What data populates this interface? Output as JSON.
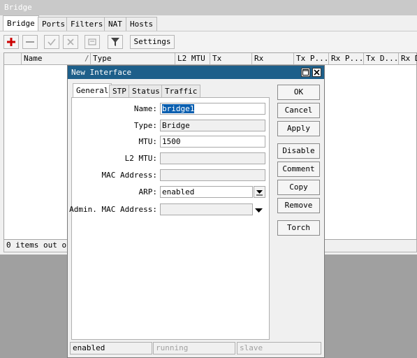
{
  "bridge_window": {
    "title": "Bridge",
    "tabs": [
      "Bridge",
      "Ports",
      "Filters",
      "NAT",
      "Hosts"
    ],
    "toolbar": {
      "settings_label": "Settings"
    },
    "columns": [
      "Name",
      "/",
      "Type",
      "L2 MTU",
      "Tx",
      "Rx",
      "Tx P...",
      "Rx P...",
      "Tx D...",
      "Rx D"
    ],
    "status_text": "0 items out of"
  },
  "dialog": {
    "title": "New Interface",
    "tabs": [
      "General",
      "STP",
      "Status",
      "Traffic"
    ],
    "fields": {
      "name": {
        "label": "Name:",
        "value": "bridge1"
      },
      "type": {
        "label": "Type:",
        "value": "Bridge"
      },
      "mtu": {
        "label": "MTU:",
        "value": "1500"
      },
      "l2mtu": {
        "label": "L2 MTU:",
        "value": ""
      },
      "mac": {
        "label": "MAC Address:",
        "value": ""
      },
      "arp": {
        "label": "ARP:",
        "value": "enabled"
      },
      "admin_mac": {
        "label": "Admin. MAC Address:",
        "value": ""
      }
    },
    "buttons": {
      "ok": "OK",
      "cancel": "Cancel",
      "apply": "Apply",
      "disable": "Disable",
      "comment": "Comment",
      "copy": "Copy",
      "remove": "Remove",
      "torch": "Torch"
    },
    "status": [
      "enabled",
      "running",
      "slave"
    ]
  },
  "colors": {
    "dialog_title_bg": "#1d5f8a",
    "selection": "#0a5fb0",
    "add_icon": "#cc0000"
  }
}
